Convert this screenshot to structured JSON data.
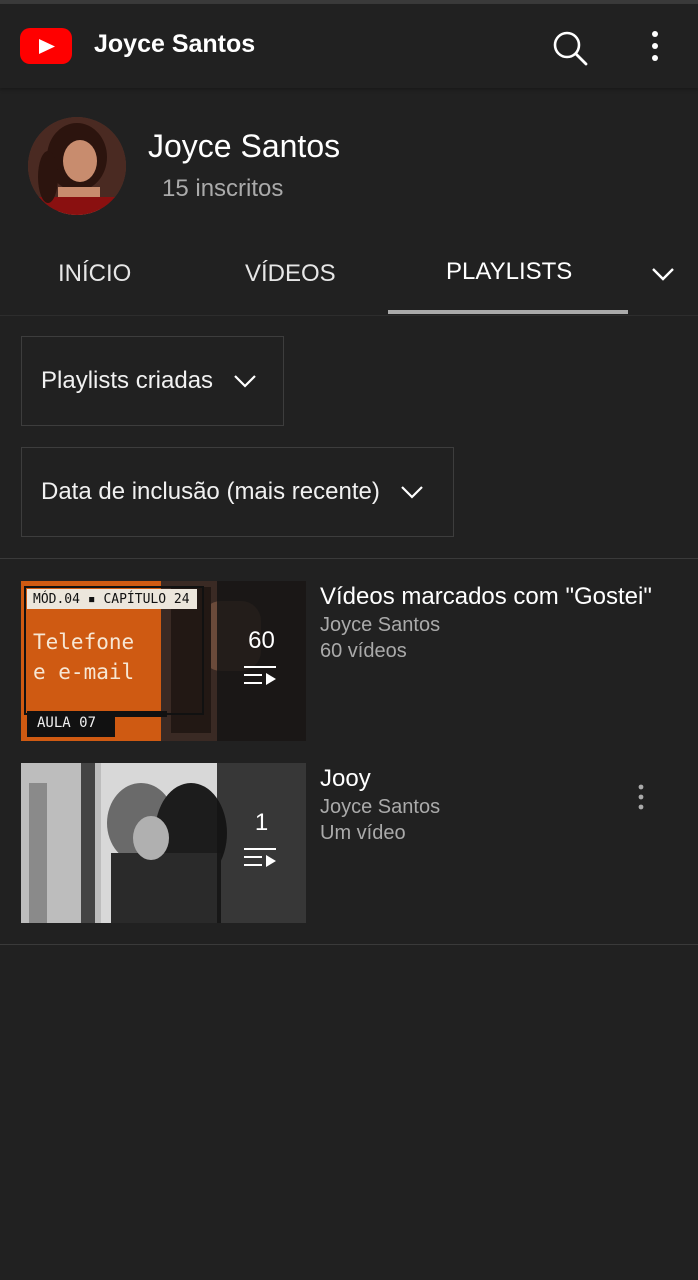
{
  "appbar": {
    "title": "Joyce Santos",
    "logo_icon": "youtube-logo",
    "search_icon": "search-icon",
    "more_icon": "more-vert-icon"
  },
  "channel": {
    "name": "Joyce Santos",
    "subscribers": "15 inscritos"
  },
  "tabs": [
    {
      "label": "INÍCIO",
      "active": false
    },
    {
      "label": "VÍDEOS",
      "active": false
    },
    {
      "label": "PLAYLISTS",
      "active": true
    }
  ],
  "filters": {
    "type_label": "Playlists criadas",
    "sort_label": "Data de inclusão (mais recente)"
  },
  "playlists": [
    {
      "title": "Vídeos marcados com \"Gostei\"",
      "owner": "Joyce Santos",
      "count_text": "60 vídeos",
      "count": "60",
      "thumb": {
        "top_tag": "MÓD.04 ▪ CAPÍTULO 24",
        "headline_1": "Telefone",
        "headline_2": "e e-mail",
        "bottom_tag": "AULA 07"
      }
    },
    {
      "title": "Jooy",
      "owner": "Joyce Santos",
      "count_text": "Um vídeo",
      "count": "1"
    }
  ],
  "colors": {
    "background": "#212121",
    "accent_red": "#ff0000",
    "secondary_text": "#aaaaaa"
  }
}
